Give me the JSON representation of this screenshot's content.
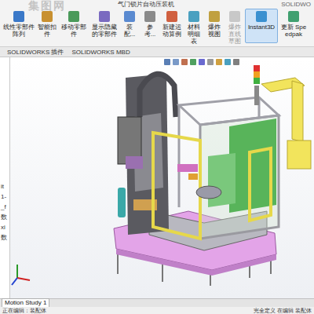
{
  "window": {
    "title": "气门锁片自动压装机",
    "app": "SOLIDWO"
  },
  "watermark": "集图网",
  "toolbar": [
    {
      "label": "线性零部件阵列",
      "selected": false,
      "disabled": false
    },
    {
      "label": "智能扣件",
      "selected": false,
      "disabled": false
    },
    {
      "label": "移动零部件",
      "selected": false,
      "disabled": false
    },
    {
      "label": "显示隐藏的零部件",
      "selected": false,
      "disabled": false
    },
    {
      "label": "装配...",
      "selected": false,
      "disabled": false
    },
    {
      "label": "参考...",
      "selected": false,
      "disabled": false
    },
    {
      "label": "新建运动算例",
      "selected": false,
      "disabled": false
    },
    {
      "label": "材料明细表",
      "selected": false,
      "disabled": false
    },
    {
      "label": "爆炸视图",
      "selected": false,
      "disabled": false
    },
    {
      "label": "爆炸直线草图",
      "selected": false,
      "disabled": true
    },
    {
      "label": "Instant3D",
      "selected": true,
      "disabled": false
    },
    {
      "label": "更新 Speedpak",
      "selected": false,
      "disabled": false
    }
  ],
  "tabs": [
    {
      "label": "SOLIDWORKS 插件",
      "selected": false
    },
    {
      "label": "SOLIDWORKS MBD",
      "selected": false
    }
  ],
  "feature_tree": {
    "items": [
      "it",
      "1-",
      "_f",
      "数",
      "xi",
      "数"
    ]
  },
  "motion_tab": {
    "label": "Motion Study 1",
    "selected": true
  },
  "status_bar": {
    "left": "正在编辑：装配体",
    "right": "完全定义  在编辑 装配体"
  }
}
